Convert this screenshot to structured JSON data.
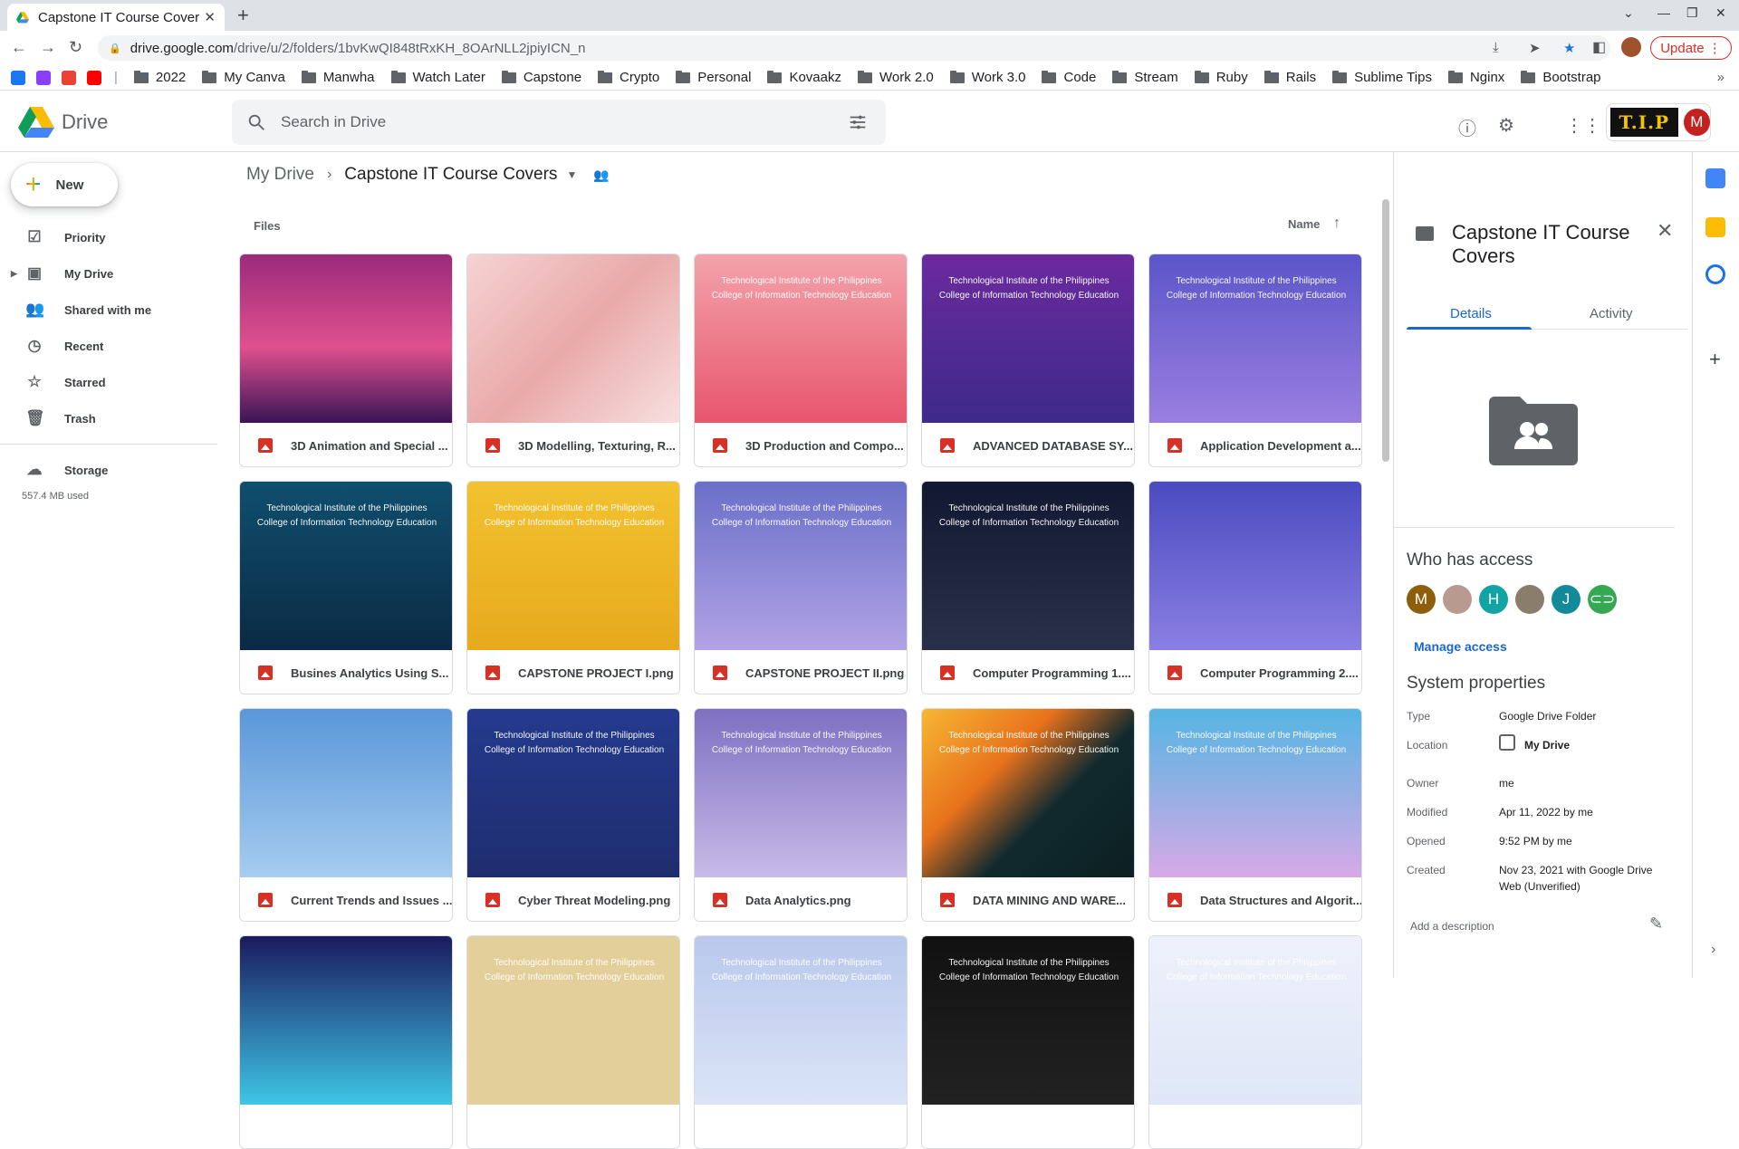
{
  "browser": {
    "tab_title": "Capstone IT Course Cover",
    "url_host": "drive.google.com",
    "url_path": "/drive/u/2/folders/1bvKwQI848tRxKH_8OArNLL2jpiyICN_n",
    "update_label": "Update",
    "bookmarks": [
      "2022",
      "My Canva",
      "Manwha",
      "Watch Later",
      "Capstone",
      "Crypto",
      "Personal",
      "Kovaakz",
      "Work 2.0",
      "Work 3.0",
      "Code",
      "Stream",
      "Ruby",
      "Rails",
      "Sublime Tips",
      "Nginx",
      "Bootstrap"
    ]
  },
  "header": {
    "app_name": "Drive",
    "search_placeholder": "Search in Drive",
    "logo_text": "T.I.P",
    "avatar_letter": "M"
  },
  "sidebar": {
    "new_label": "New",
    "items": [
      {
        "label": "Priority",
        "icon": "priority-icon"
      },
      {
        "label": "My Drive",
        "icon": "my-drive-icon"
      },
      {
        "label": "Shared with me",
        "icon": "shared-icon"
      },
      {
        "label": "Recent",
        "icon": "clock-icon"
      },
      {
        "label": "Starred",
        "icon": "star-icon"
      },
      {
        "label": "Trash",
        "icon": "trash-icon"
      }
    ],
    "storage_label": "Storage",
    "storage_used": "557.4 MB used"
  },
  "main": {
    "breadcrumb_root": "My Drive",
    "breadcrumb_current": "Capstone IT Course Covers",
    "section_label": "Files",
    "sort_label": "Name",
    "institution_line1": "Technological Institute of the Philippines",
    "institution_line2": "College of Information Technology Education",
    "files": [
      {
        "name": "3D Animation and Special ...",
        "bg": "linear-gradient(180deg,#9a2a7a 0%,#e0508f 55%,#3a1456 100%)",
        "inst": false
      },
      {
        "name": "3D Modelling, Texturing, R...",
        "bg": "linear-gradient(135deg,#f6d3d3 0%,#e9a9a9 50%,#f8e0e0 100%)",
        "inst": false
      },
      {
        "name": "3D Production and Compo...",
        "bg": "linear-gradient(180deg,#f3a3ab 0%,#e8566c 100%)",
        "inst": true
      },
      {
        "name": "ADVANCED DATABASE SY...",
        "bg": "linear-gradient(180deg,#6b2a9e 0%,#3d2a8a 100%)",
        "inst": true
      },
      {
        "name": "Application Development a...",
        "bg": "linear-gradient(180deg,#5b55c9 0%,#9a7fe0 100%)",
        "inst": true
      },
      {
        "name": "Busines Analytics Using S...",
        "bg": "linear-gradient(180deg,#0f4f6e 0%,#0b2a44 100%)",
        "inst": true
      },
      {
        "name": "CAPSTONE PROJECT I.png",
        "bg": "linear-gradient(180deg,#f2c230 0%,#e7a91d 100%)",
        "inst": true
      },
      {
        "name": "CAPSTONE PROJECT II.png",
        "bg": "linear-gradient(180deg,#6a6fc8 0%,#b2a3e6 100%)",
        "inst": true
      },
      {
        "name": "Computer Programming 1....",
        "bg": "linear-gradient(180deg,#121832 0%,#2a2f4a 100%)",
        "inst": true
      },
      {
        "name": "Computer Programming 2....",
        "bg": "linear-gradient(180deg,#4a4bc0 0%,#8b7fe3 100%)",
        "inst": false
      },
      {
        "name": "Current Trends and Issues ...",
        "bg": "linear-gradient(180deg,#5a97d9 0%,#a6ccf0 100%)",
        "inst": false
      },
      {
        "name": "Cyber Threat Modeling.png",
        "bg": "linear-gradient(180deg,#243a8e 0%,#1f2d6e 100%)",
        "inst": true
      },
      {
        "name": "Data Analytics.png",
        "bg": "linear-gradient(180deg,#7f70c2 0%,#c7bbe8 100%)",
        "inst": true
      },
      {
        "name": "DATA MINING AND WARE...",
        "bg": "linear-gradient(135deg,#f7b733 0%,#e8721c 35%,#0f2a2e 60%,#0d1f22 100%)",
        "inst": true
      },
      {
        "name": "Data Structures and Algorit...",
        "bg": "linear-gradient(180deg,#55b5e3 0%,#d7a9e6 100%)",
        "inst": true
      },
      {
        "name": "",
        "bg": "linear-gradient(180deg,#1a1a5e 0%,#3ec6e6 100%)",
        "inst": false
      },
      {
        "name": "",
        "bg": "linear-gradient(180deg,#e2cf99 0%,#e2cf99 100%)",
        "inst": true
      },
      {
        "name": "",
        "bg": "linear-gradient(180deg,#b9c8ec 0%,#dbe4f7 100%)",
        "inst": true
      },
      {
        "name": "",
        "bg": "linear-gradient(180deg,#111 0%,#222 100%)",
        "inst": true
      },
      {
        "name": "",
        "bg": "linear-gradient(180deg,#eef1fb 0%,#dfe6f7 100%)",
        "inst": true
      }
    ]
  },
  "details": {
    "title": "Capstone IT Course Covers",
    "tab_details": "Details",
    "tab_activity": "Activity",
    "who_has_access": "Who has access",
    "access": [
      {
        "letter": "M",
        "color": "#8d5f0a"
      },
      {
        "letter": "",
        "color": "#b99a8e"
      },
      {
        "letter": "H",
        "color": "#12a4a4"
      },
      {
        "letter": "",
        "color": "#8a7d6b"
      },
      {
        "letter": "J",
        "color": "#128a9a"
      },
      {
        "letter": "",
        "color": "#34a853"
      }
    ],
    "manage_access": "Manage access",
    "system_properties": "System properties",
    "props": {
      "type_k": "Type",
      "type_v": "Google Drive Folder",
      "location_k": "Location",
      "location_v": "My Drive",
      "owner_k": "Owner",
      "owner_v": "me",
      "modified_k": "Modified",
      "modified_v": "Apr 11, 2022 by me",
      "opened_k": "Opened",
      "opened_v": "9:52 PM by me",
      "created_k": "Created",
      "created_v": "Nov 23, 2021 with Google Drive Web (Unverified)"
    },
    "add_description": "Add a description"
  }
}
